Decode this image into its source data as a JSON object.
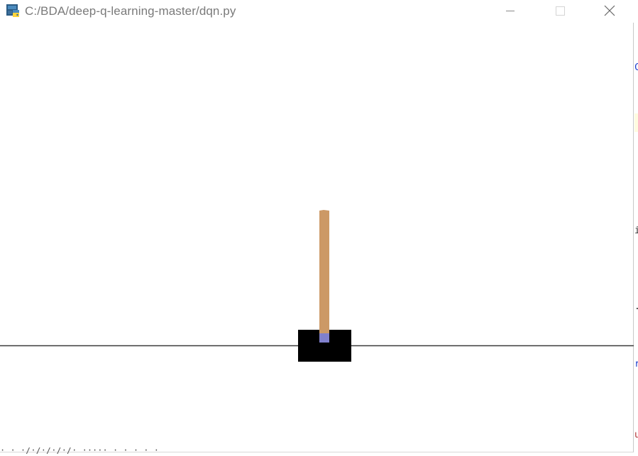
{
  "window": {
    "title": "C:/BDA/deep-q-learning-master/dqn.py",
    "icon": "python-icon",
    "controls": {
      "minimize_icon": "minimize-icon",
      "maximize_icon": "maximize-icon",
      "close_icon": "close-icon"
    }
  },
  "scene": {
    "background": "#ffffff",
    "track_color": "#3a3a3a",
    "cart_color": "#000000",
    "pole_color": "#cc9966",
    "axle_color": "#8080cc"
  }
}
